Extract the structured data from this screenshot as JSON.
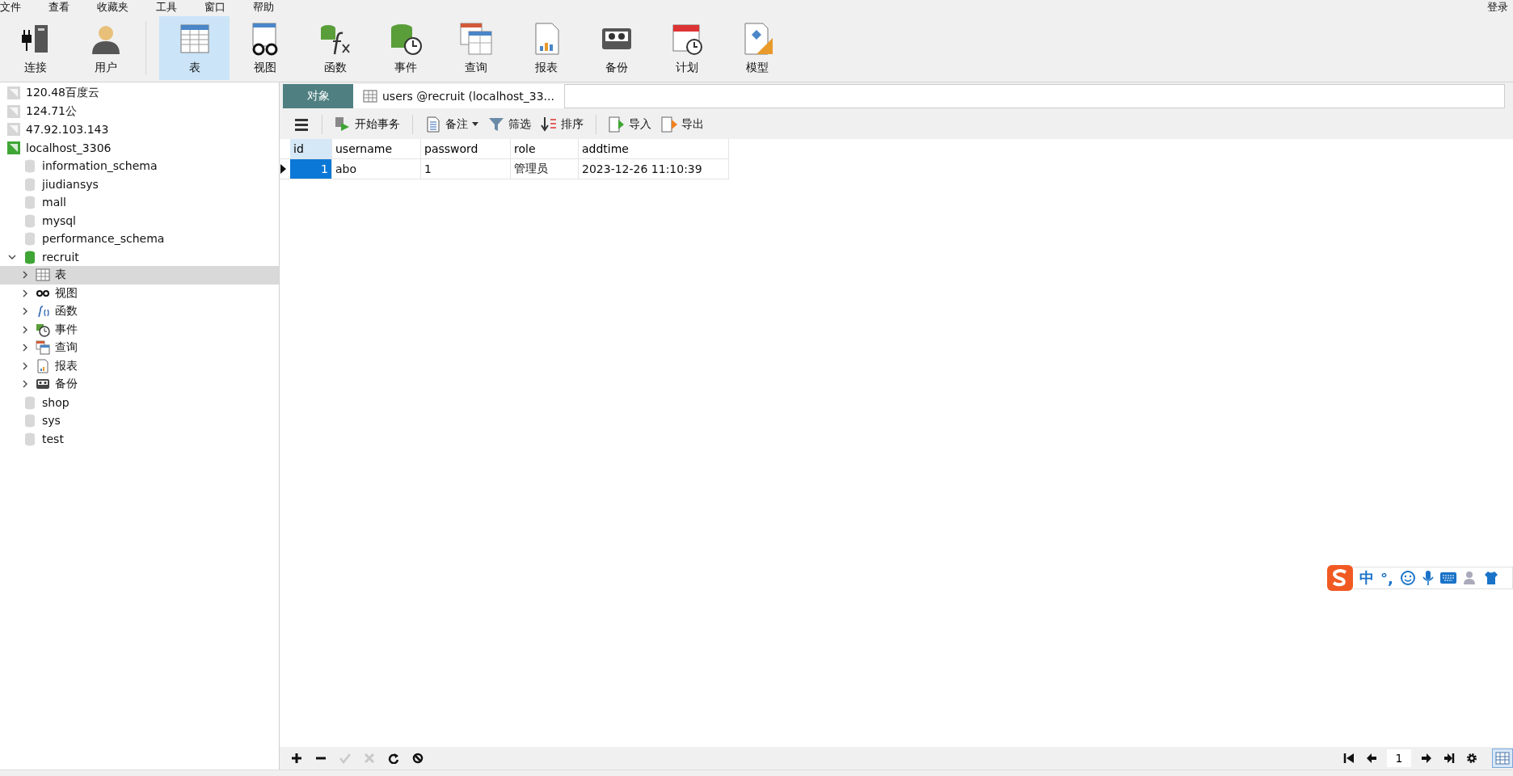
{
  "menu": [
    "文件",
    "查看",
    "收藏夹",
    "工具",
    "窗口",
    "帮助"
  ],
  "login": "登录",
  "toolbar": [
    {
      "kind": "connect",
      "label": "连接",
      "selected": false
    },
    {
      "kind": "user",
      "label": "用户",
      "selected": false
    },
    {
      "kind": "table",
      "label": "表",
      "selected": true
    },
    {
      "kind": "view",
      "label": "视图",
      "selected": false
    },
    {
      "kind": "function",
      "label": "函数",
      "selected": false
    },
    {
      "kind": "event",
      "label": "事件",
      "selected": false
    },
    {
      "kind": "query",
      "label": "查询",
      "selected": false
    },
    {
      "kind": "report",
      "label": "报表",
      "selected": false
    },
    {
      "kind": "backup",
      "label": "备份",
      "selected": false
    },
    {
      "kind": "schedule",
      "label": "计划",
      "selected": false
    },
    {
      "kind": "model",
      "label": "模型",
      "selected": false
    }
  ],
  "tree": [
    {
      "kind": "connection",
      "label": "120.48百度云",
      "open": false
    },
    {
      "kind": "connection",
      "label": "124.71公",
      "open": false
    },
    {
      "kind": "connection",
      "label": "47.92.103.143",
      "open": false
    },
    {
      "kind": "connection",
      "label": "localhost_3306",
      "open": true,
      "children": [
        {
          "kind": "database",
          "label": "information_schema",
          "open": false
        },
        {
          "kind": "database",
          "label": "jiudiansys",
          "open": false
        },
        {
          "kind": "database",
          "label": "mall",
          "open": false
        },
        {
          "kind": "database",
          "label": "mysql",
          "open": false
        },
        {
          "kind": "database",
          "label": "performance_schema",
          "open": false
        },
        {
          "kind": "database",
          "label": "recruit",
          "open": true,
          "expanded": true,
          "children": [
            {
              "kind": "table",
              "label": "表",
              "selected": true
            },
            {
              "kind": "view",
              "label": "视图",
              "selected": false
            },
            {
              "kind": "function",
              "label": "函数",
              "selected": false
            },
            {
              "kind": "event",
              "label": "事件",
              "selected": false
            },
            {
              "kind": "query",
              "label": "查询",
              "selected": false
            },
            {
              "kind": "report",
              "label": "报表",
              "selected": false
            },
            {
              "kind": "backup",
              "label": "备份",
              "selected": false
            }
          ]
        },
        {
          "kind": "database",
          "label": "shop",
          "open": false
        },
        {
          "kind": "database",
          "label": "sys",
          "open": false
        },
        {
          "kind": "database",
          "label": "test",
          "open": false
        }
      ]
    }
  ],
  "tabs": [
    {
      "kind": "objects",
      "label": "对象",
      "selected": false
    },
    {
      "kind": "table",
      "label": "users @recruit (localhost_33...",
      "selected": true
    }
  ],
  "actions": [
    {
      "kind": "menu"
    },
    {
      "kind": "transaction",
      "label": "开始事务"
    },
    {
      "kind": "memo",
      "label": "备注"
    },
    {
      "kind": "filter",
      "label": "筛选"
    },
    {
      "kind": "sort",
      "label": "排序"
    },
    {
      "kind": "import",
      "label": "导入"
    },
    {
      "kind": "export",
      "label": "导出"
    }
  ],
  "grid": {
    "columns": [
      "id",
      "username",
      "password",
      "role",
      "addtime"
    ],
    "rows": [
      {
        "selected": true,
        "cells": [
          "1",
          "abo",
          "1",
          "管理员",
          "2023-12-26 11:10:39"
        ]
      }
    ]
  },
  "record_buttons": [
    {
      "kind": "add",
      "disabled": false
    },
    {
      "kind": "delete",
      "disabled": false
    },
    {
      "kind": "apply",
      "disabled": true
    },
    {
      "kind": "discard",
      "disabled": true
    },
    {
      "kind": "refresh",
      "disabled": false
    },
    {
      "kind": "stop",
      "disabled": false
    }
  ],
  "pager": {
    "page": "1"
  },
  "ime": {
    "mode": "中",
    "punct": "°,"
  }
}
